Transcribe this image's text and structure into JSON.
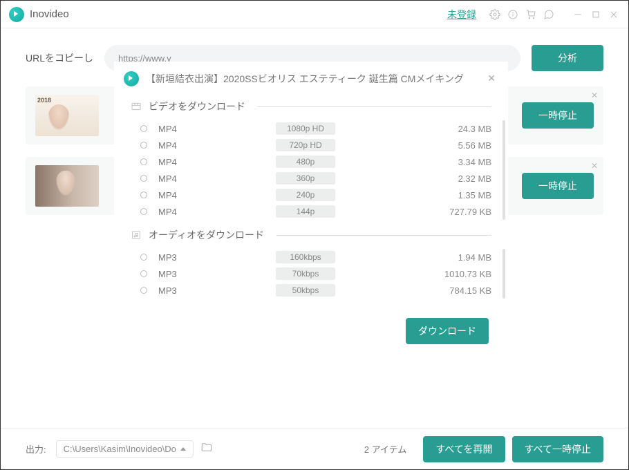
{
  "titlebar": {
    "app_name": "Inovideo",
    "unregistered": "未登録"
  },
  "url_section": {
    "label": "URLをコピーし",
    "placeholder": "https://www.y",
    "analyze_btn": "分析"
  },
  "downloads": [
    {
      "pause_btn": "一時停止"
    },
    {
      "pause_btn": "一時停止"
    }
  ],
  "modal": {
    "title": "【新垣結衣出演】2020SSビオリス エステティーク 誕生篇 CMメイキング",
    "video_section": "ビデオをダウンロード",
    "audio_section": "オーディオをダウンロード",
    "download_btn": "ダウンロード",
    "video_options": [
      {
        "format": "MP4",
        "quality": "1080p HD",
        "size": "24.3 MB"
      },
      {
        "format": "MP4",
        "quality": "720p HD",
        "size": "5.56 MB"
      },
      {
        "format": "MP4",
        "quality": "480p",
        "size": "3.34 MB"
      },
      {
        "format": "MP4",
        "quality": "360p",
        "size": "2.32 MB"
      },
      {
        "format": "MP4",
        "quality": "240p",
        "size": "1.35 MB"
      },
      {
        "format": "MP4",
        "quality": "144p",
        "size": "727.79 KB"
      }
    ],
    "audio_options": [
      {
        "format": "MP3",
        "quality": "160kbps",
        "size": "1.94 MB"
      },
      {
        "format": "MP3",
        "quality": "70kbps",
        "size": "1010.73 KB"
      },
      {
        "format": "MP3",
        "quality": "50kbps",
        "size": "784.15 KB"
      }
    ]
  },
  "footer": {
    "output_label": "出力:",
    "path": "C:\\Users\\Kasim\\Inovideo\\Do",
    "item_count": "2 アイテム",
    "resume_all": "すべてを再開",
    "pause_all": "すべて一時停止"
  },
  "colors": {
    "accent": "#2a9d93"
  }
}
